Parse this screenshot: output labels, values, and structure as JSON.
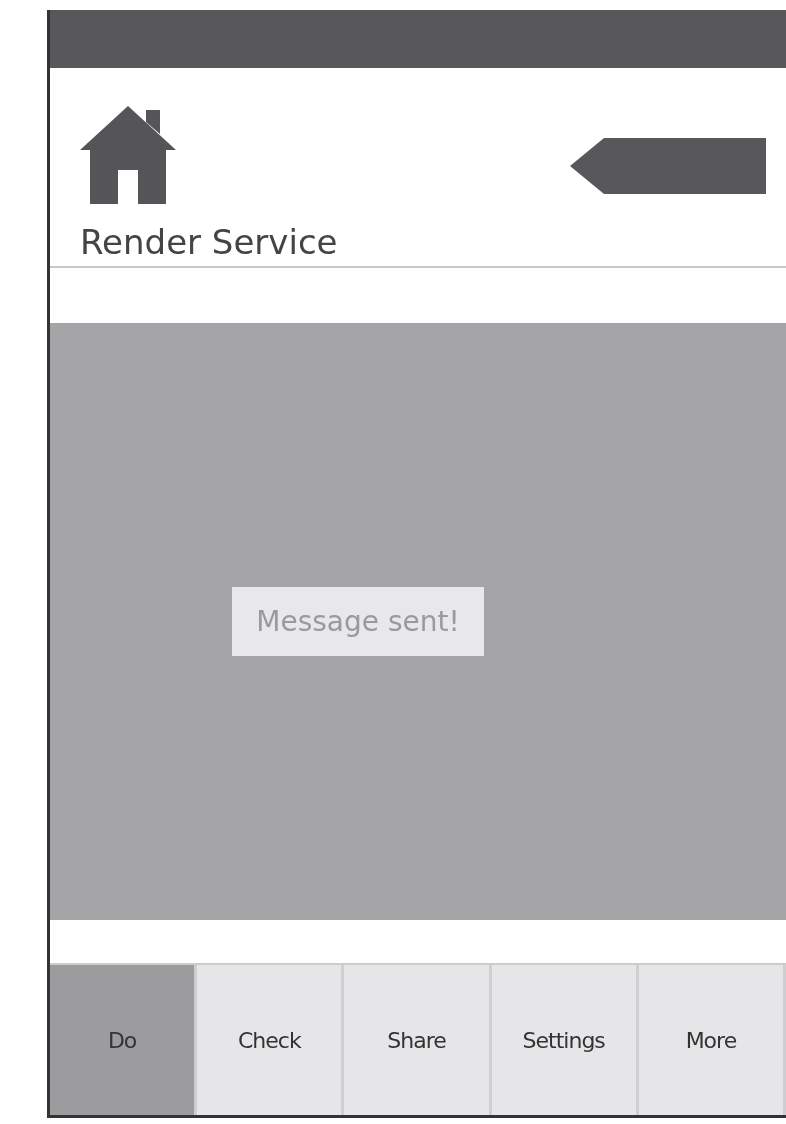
{
  "header": {
    "title": "Render Service"
  },
  "toast": {
    "message": "Message sent!"
  },
  "tabs": [
    {
      "label": "Do",
      "selected": true
    },
    {
      "label": "Check",
      "selected": false
    },
    {
      "label": "Share",
      "selected": false
    },
    {
      "label": "Settings",
      "selected": false
    },
    {
      "label": "More",
      "selected": false
    }
  ]
}
